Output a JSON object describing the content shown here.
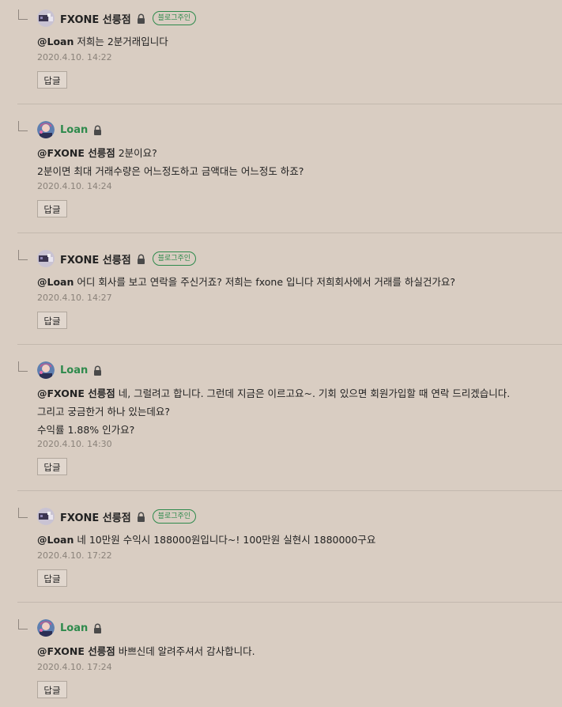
{
  "comments": [
    {
      "author": "FXONE 선릉점",
      "owner_badge": "블로그주인",
      "lines": [
        {
          "mention": "@Loan",
          "text": " 저희는 2분거래입니다"
        }
      ],
      "date": "2020.4.10. 14:22",
      "reply_label": "답글"
    },
    {
      "author": "Loan",
      "lines": [
        {
          "mention": "@FXONE 선릉점",
          "text": " 2분이요?"
        },
        {
          "mention": "",
          "text": "2분이면 최대 거래수량은 어느정도하고 금액대는 어느정도 하죠?"
        }
      ],
      "date": "2020.4.10. 14:24",
      "reply_label": "답글"
    },
    {
      "author": "FXONE 선릉점",
      "owner_badge": "블로그주인",
      "lines": [
        {
          "mention": "@Loan",
          "text": " 어디 회사를 보고 연락을 주신거죠? 저희는 fxone 입니다 저희회사에서 거래를 하실건가요?"
        }
      ],
      "date": "2020.4.10. 14:27",
      "reply_label": "답글"
    },
    {
      "author": "Loan",
      "lines": [
        {
          "mention": "@FXONE 선릉점",
          "text": " 네, 그럴려고 합니다. 그런데 지금은 이르고요~. 기회 있으면 회원가입할 때 연락 드리겠습니다."
        },
        {
          "mention": "",
          "text": "그리고 궁금한거 하나 있는데요?"
        },
        {
          "mention": "",
          "text": "수익률 1.88% 인가요?"
        }
      ],
      "date": "2020.4.10. 14:30",
      "reply_label": "답글"
    },
    {
      "author": "FXONE 선릉점",
      "owner_badge": "블로그주인",
      "lines": [
        {
          "mention": "@Loan",
          "text": " 네 10만원 수익시 188000원입니다~! 100만원 실현시 1880000구요"
        }
      ],
      "date": "2020.4.10. 17:22",
      "reply_label": "답글"
    },
    {
      "author": "Loan",
      "lines": [
        {
          "mention": "@FXONE 선릉점",
          "text": " 바쁘신데 알려주셔서 감사합니다."
        }
      ],
      "date": "2020.4.10. 17:24",
      "reply_label": "답글"
    }
  ],
  "colors": {
    "background": "#d9cdc2",
    "owner_name": "#222222",
    "guest_name": "#2e8a4c",
    "badge": "#2e8a4c",
    "date": "#8a827a"
  },
  "icons": {
    "reply_indent": "reply-arrow-icon",
    "lock": "lock-icon",
    "owner_avatar": "fxone-logo-avatar",
    "guest_avatar": "anime-profile-avatar"
  }
}
